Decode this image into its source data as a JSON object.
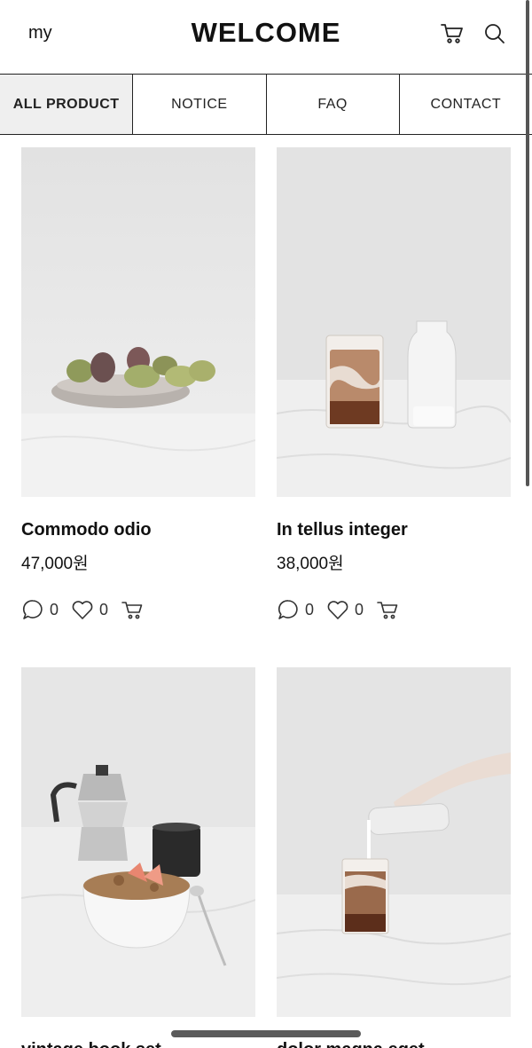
{
  "header": {
    "my_label": "my",
    "title": "WELCOME",
    "cart_icon": "cart-icon",
    "search_icon": "search-icon"
  },
  "tabs": [
    {
      "label": "ALL PRODUCT",
      "active": true
    },
    {
      "label": "NOTICE",
      "active": false
    },
    {
      "label": "FAQ",
      "active": false
    },
    {
      "label": "CONTACT",
      "active": false
    }
  ],
  "products": [
    {
      "name": "Commodo odio",
      "price": "47,000원",
      "comments": "0",
      "likes": "0"
    },
    {
      "name": "In tellus integer",
      "price": "38,000원",
      "comments": "0",
      "likes": "0"
    },
    {
      "name": "vintage book set",
      "price": "",
      "comments": "",
      "likes": ""
    },
    {
      "name": "dolor magna eget",
      "price": "",
      "comments": "",
      "likes": ""
    }
  ],
  "colors": {
    "text": "#111111",
    "active_tab_bg": "#efefef",
    "photo_bg": "#e6e6e6",
    "divider": "#222222"
  }
}
